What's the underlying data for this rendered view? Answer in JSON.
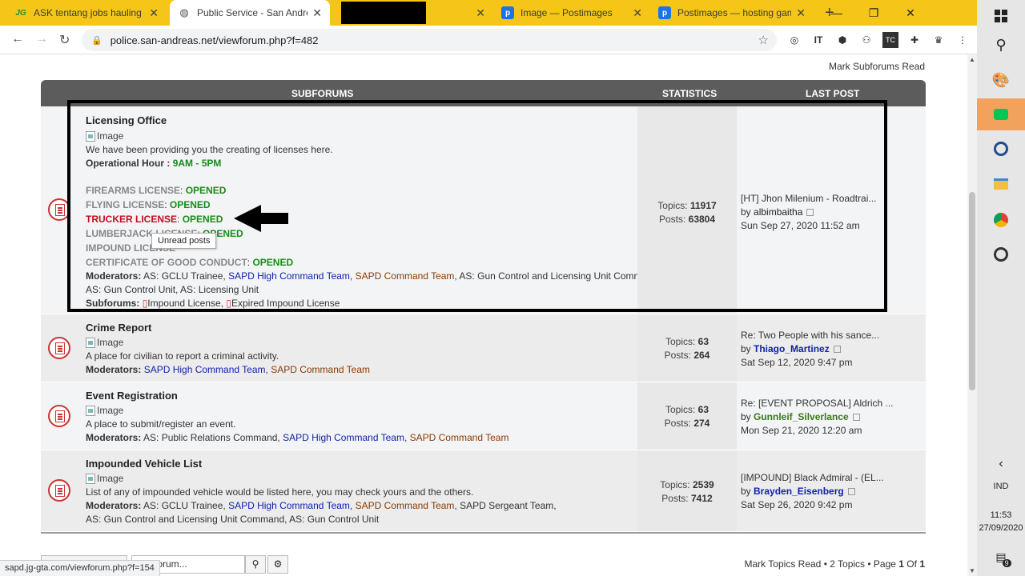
{
  "browser": {
    "tabs": [
      {
        "label": "ASK tentang jobs hauling - P",
        "icon": "jg-favicon"
      },
      {
        "label": "Public Service - San Andreas",
        "icon": "globe-favicon"
      },
      {
        "label": "",
        "icon": "redacted"
      },
      {
        "label": "Image — Postimages",
        "icon": "postimages-favicon"
      },
      {
        "label": "Postimages — hosting gam",
        "icon": "postimages-favicon"
      }
    ],
    "url": "police.san-andreas.net/viewforum.php?f=482",
    "status_url": "sapd.jg-gta.com/viewforum.php?f=154",
    "colors": {
      "tabbar": "#f5c518"
    }
  },
  "forum": {
    "mark_subforums": "Mark Subforums Read",
    "headers": {
      "subforums": "SUBFORUMS",
      "statistics": "STATISTICS",
      "last_post": "LAST POST"
    },
    "image_alt": "Image",
    "tooltip": "Unread posts",
    "licensing": {
      "title": "Licensing Office",
      "desc": "We have been providing you the creating of licenses here.",
      "op_label": "Operational Hour :",
      "op_value": "9AM - 5PM",
      "licenses": [
        {
          "name": "FIREARMS LICENSE",
          "status": "OPENED"
        },
        {
          "name": "FLYING LICENSE",
          "status": "OPENED"
        },
        {
          "name": "TRUCKER LICENSE",
          "status": "OPENED"
        },
        {
          "name": "LUMBERJACK LICENSE",
          "status": "OPENED"
        },
        {
          "name": "IMPOUND LICENSE",
          "status": ""
        },
        {
          "name": "CERTIFICATE OF GOOD CONDUCT",
          "status": "OPENED"
        }
      ],
      "moderators_label": "Moderators:",
      "mod_1": "AS: GCLU Trainee,",
      "mod_2": "SAPD High Command Team",
      "mod_3": "SAPD Command Team",
      "mod_4": ", AS: Gun Control and Licensing Unit Command,",
      "mod_line2": "AS: Gun Control Unit, AS: Licensing Unit",
      "subforums_label": "Subforums:",
      "sub_1": "Impound License",
      "sub_2": "Expired Impound License",
      "topics": "11917",
      "posts": "63804",
      "last_title": "[HT] Jhon Milenium - Roadtrai...",
      "last_user": "albimbaitha",
      "last_date": "Sun Sep 27, 2020 11:52 am"
    },
    "crime": {
      "title": "Crime Report",
      "desc": "A place for civilian to report a criminal activity.",
      "moderators_label": "Moderators:",
      "mod_1": "SAPD High Command Team",
      "mod_2": "SAPD Command Team",
      "topics": "63",
      "posts": "264",
      "last_title": "Re: Two People with his sance...",
      "last_user": "Thiago_Martinez",
      "last_date": "Sat Sep 12, 2020 9:47 pm"
    },
    "event": {
      "title": "Event Registration",
      "desc": "A place to submit/register an event.",
      "moderators_label": "Moderators:",
      "mod_1": "AS: Public Relations Command,",
      "mod_2": "SAPD High Command Team",
      "mod_3": "SAPD Command Team",
      "topics": "63",
      "posts": "274",
      "last_title": "Re: [EVENT PROPOSAL] Aldrich ...",
      "last_user": "Gunnleif_Silverlance",
      "last_date": "Mon Sep 21, 2020 12:20 am"
    },
    "impounded": {
      "title": "Impounded Vehicle List",
      "desc": "List of any of impounded vehicle would be listed here, you may check yours and the others.",
      "moderators_label": "Moderators:",
      "mod_1": "AS: GCLU Trainee,",
      "mod_2": "SAPD High Command Team",
      "mod_3": "SAPD Command Team",
      "mod_4": ", SAPD Sergeant Team,",
      "mod_line2": "AS: Gun Control and Licensing Unit Command, AS: Gun Control Unit",
      "topics": "2539",
      "posts": "7412",
      "last_title": "[IMPOUND] Black Admiral - (EL...",
      "last_user": "Brayden_Eisenberg",
      "last_date": "Sat Sep 26, 2020 9:42 pm"
    },
    "stat_labels": {
      "topics": "Topics:",
      "posts": "Posts:"
    },
    "search_placeholder": "this forum...",
    "mark_topics": "Mark Topics Read",
    "pager_info": "• 2 Topics • Page",
    "page_current": "1",
    "page_of": "Of",
    "page_total": "1"
  },
  "taskbar": {
    "lang": "IND",
    "time": "11:53",
    "date": "27/09/2020",
    "notif_count": "9"
  }
}
